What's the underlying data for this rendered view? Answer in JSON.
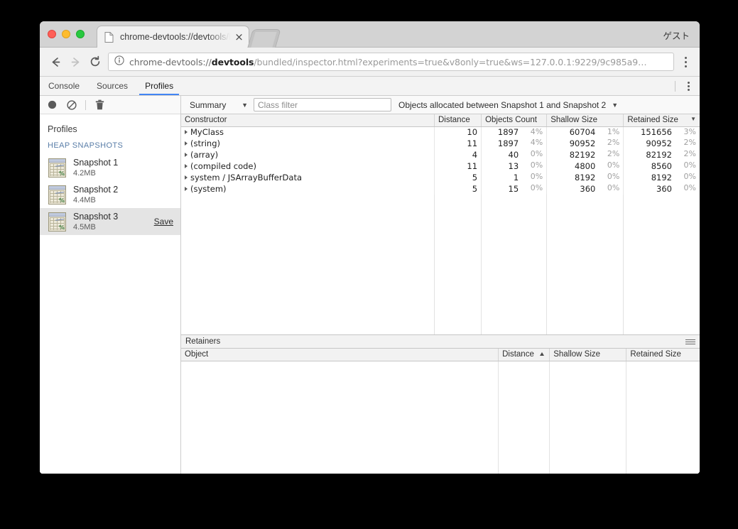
{
  "browser": {
    "guest_label": "ゲスト",
    "tab": {
      "title": "chrome-devtools://devtools/bundled/inspector.html",
      "close_label": "×",
      "icon": "page-icon"
    },
    "nav": {
      "back_icon": "back-arrow-icon",
      "forward_icon": "forward-arrow-icon",
      "reload_icon": "reload-icon",
      "menu_icon": "kebab-menu-icon"
    },
    "omnibox": {
      "info_icon": "info-circle-icon",
      "url_prefix": "chrome-devtools://",
      "url_host": "devtools",
      "url_rest": "/bundled/inspector.html?experiments=true&v8only=true&ws=127.0.0.1:9229/9c985a9…"
    }
  },
  "devtools": {
    "tabs": [
      {
        "label": "Console",
        "active": false
      },
      {
        "label": "Sources",
        "active": false
      },
      {
        "label": "Profiles",
        "active": true
      }
    ],
    "menu_icon": "kebab-menu-icon",
    "sidebar": {
      "toolbar": [
        {
          "name": "record-button",
          "icon": "record-circle-icon"
        },
        {
          "name": "clear-button",
          "icon": "no-entry-icon"
        },
        {
          "name": "delete-button",
          "icon": "trash-icon"
        }
      ],
      "title": "Profiles",
      "group_label": "HEAP SNAPSHOTS",
      "snapshots": [
        {
          "name": "Snapshot 1",
          "size": "4.2MB",
          "selected": false,
          "save_label": ""
        },
        {
          "name": "Snapshot 2",
          "size": "4.4MB",
          "selected": false,
          "save_label": ""
        },
        {
          "name": "Snapshot 3",
          "size": "4.5MB",
          "selected": true,
          "save_label": "Save"
        }
      ]
    },
    "main": {
      "view_select": {
        "value": "Summary",
        "caret": "▼"
      },
      "class_filter": {
        "placeholder": "Class filter",
        "value": ""
      },
      "allocation_select": {
        "value": "Objects allocated between Snapshot 1 and Snapshot 2",
        "caret": "▼"
      },
      "grid": {
        "columns": [
          {
            "label": "Constructor",
            "sorted": false
          },
          {
            "label": "Distance",
            "sorted": false
          },
          {
            "label": "Objects Count",
            "sorted": false
          },
          {
            "label": "Shallow Size",
            "sorted": false
          },
          {
            "label": "Retained Size",
            "sorted": true,
            "sort_dir": "▼"
          }
        ],
        "rows": [
          {
            "constructor": "MyClass",
            "distance": "10",
            "objects_count": "1897",
            "objects_pct": "4%",
            "shallow_size": "60704",
            "shallow_pct": "1%",
            "retained_size": "151656",
            "retained_pct": "3%"
          },
          {
            "constructor": "(string)",
            "distance": "11",
            "objects_count": "1897",
            "objects_pct": "4%",
            "shallow_size": "90952",
            "shallow_pct": "2%",
            "retained_size": "90952",
            "retained_pct": "2%"
          },
          {
            "constructor": "(array)",
            "distance": "4",
            "objects_count": "40",
            "objects_pct": "0%",
            "shallow_size": "82192",
            "shallow_pct": "2%",
            "retained_size": "82192",
            "retained_pct": "2%"
          },
          {
            "constructor": "(compiled code)",
            "distance": "11",
            "objects_count": "13",
            "objects_pct": "0%",
            "shallow_size": "4800",
            "shallow_pct": "0%",
            "retained_size": "8560",
            "retained_pct": "0%"
          },
          {
            "constructor": "system / JSArrayBufferData",
            "distance": "5",
            "objects_count": "1",
            "objects_pct": "0%",
            "shallow_size": "8192",
            "shallow_pct": "0%",
            "retained_size": "8192",
            "retained_pct": "0%"
          },
          {
            "constructor": "(system)",
            "distance": "5",
            "objects_count": "15",
            "objects_pct": "0%",
            "shallow_size": "360",
            "shallow_pct": "0%",
            "retained_size": "360",
            "retained_pct": "0%"
          }
        ]
      },
      "retainers": {
        "title": "Retainers",
        "menu_icon": "hamburger-menu-icon",
        "columns": [
          {
            "label": "Object",
            "sorted": false
          },
          {
            "label": "Distance",
            "sorted": true,
            "sort_dir": "▲"
          },
          {
            "label": "Shallow Size",
            "sorted": false
          },
          {
            "label": "Retained Size",
            "sorted": false
          }
        ],
        "rows": []
      }
    }
  },
  "colors": {
    "accent": "#4285f4",
    "group_label": "#5a7ea8",
    "selected_row": "#e4e4e4",
    "percent_text": "#a0a0a0"
  }
}
